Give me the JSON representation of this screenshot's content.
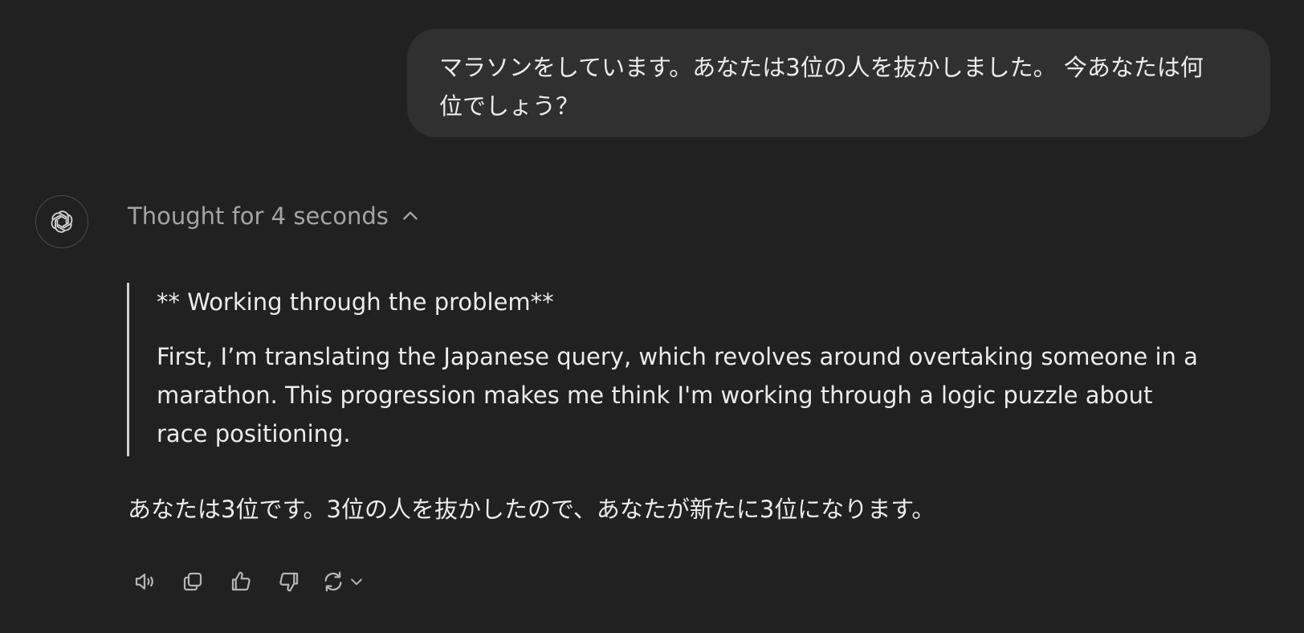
{
  "user_message": {
    "line1": "マラソンをしています。あなたは3位の人を抜かしました。 今あなたは何",
    "line2": "位でしょう？"
  },
  "assistant": {
    "avatar_icon": "openai-logo-icon",
    "thought_label": "Thought for 4 seconds",
    "thought_toggle_icon": "chevron-up-icon",
    "reasoning": {
      "heading": "** Working through the problem**",
      "body": "First, I’m translating the Japanese query, which revolves around overtaking someone in a marathon. This progression makes me think I'm working through a logic puzzle about race positioning."
    },
    "answer": "あなたは3位です。3位の人を抜かしたので、あなたが新たに3位になります。"
  },
  "actions": [
    {
      "name": "read-aloud-button",
      "icon": "speaker-icon"
    },
    {
      "name": "copy-button",
      "icon": "copy-icon"
    },
    {
      "name": "thumbs-up-button",
      "icon": "thumbs-up-icon"
    },
    {
      "name": "thumbs-down-button",
      "icon": "thumbs-down-icon"
    },
    {
      "name": "regenerate-button",
      "icon": "refresh-icon"
    }
  ],
  "colors": {
    "background": "#212121",
    "bubble": "#303030",
    "text": "#ececec",
    "muted": "#a4a4a4",
    "icon": "#b4b4b4"
  }
}
